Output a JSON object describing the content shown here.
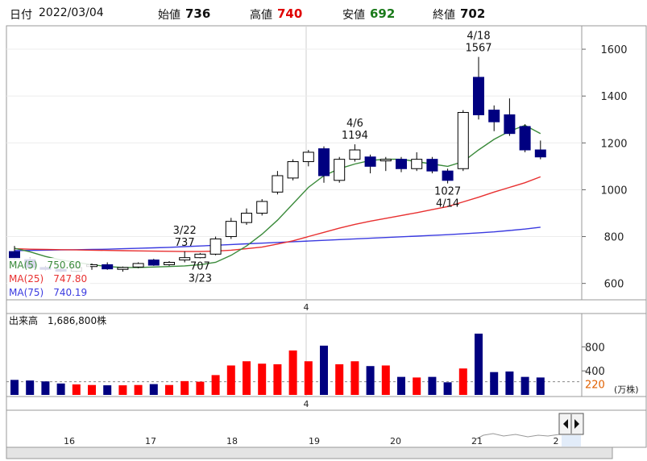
{
  "header": {
    "date_label": "日付",
    "date": "2022/03/04",
    "open_label": "始値",
    "open": "736",
    "high_label": "高値",
    "high": "740",
    "low_label": "安値",
    "low": "692",
    "close_label": "終値",
    "close": "702"
  },
  "legend": {
    "ma5": "MA(5)　750.60",
    "ma25": "MA(25)　747.80",
    "ma75": "MA(75)　740.19",
    "volume": "出来高　1,686,800株"
  },
  "colors": {
    "up": "#ff0000",
    "down": "#000080",
    "ma5": "#3a8a3a",
    "ma25": "#e83030",
    "ma75": "#3a3ae0"
  },
  "chart_data": {
    "type": "candlestick",
    "price_axis": {
      "ticks": [
        600,
        800,
        1000,
        1200,
        1400,
        1600
      ],
      "ylim": [
        530,
        1700
      ]
    },
    "volume_axis": {
      "ticks": [
        400,
        800
      ],
      "ylim": [
        0,
        1100
      ],
      "unit": "(万株)",
      "ref_line": 220
    },
    "week_marker": "4",
    "candles": [
      {
        "o": 736,
        "h": 760,
        "l": 700,
        "c": 705
      },
      {
        "o": 702,
        "h": 710,
        "l": 660,
        "c": 668
      },
      {
        "o": 668,
        "h": 675,
        "l": 655,
        "c": 660
      },
      {
        "o": 660,
        "h": 670,
        "l": 648,
        "c": 652
      },
      {
        "o": 652,
        "h": 672,
        "l": 648,
        "c": 668
      },
      {
        "o": 672,
        "h": 685,
        "l": 658,
        "c": 680
      },
      {
        "o": 680,
        "h": 690,
        "l": 658,
        "c": 662
      },
      {
        "o": 660,
        "h": 672,
        "l": 650,
        "c": 668
      },
      {
        "o": 670,
        "h": 690,
        "l": 665,
        "c": 685
      },
      {
        "o": 700,
        "h": 705,
        "l": 675,
        "c": 678
      },
      {
        "o": 680,
        "h": 695,
        "l": 675,
        "c": 690
      },
      {
        "o": 700,
        "h": 737,
        "l": 690,
        "c": 710
      },
      {
        "o": 710,
        "h": 730,
        "l": 707,
        "c": 725
      },
      {
        "o": 725,
        "h": 800,
        "l": 720,
        "c": 790
      },
      {
        "o": 800,
        "h": 880,
        "l": 790,
        "c": 865
      },
      {
        "o": 860,
        "h": 920,
        "l": 850,
        "c": 900
      },
      {
        "o": 900,
        "h": 960,
        "l": 890,
        "c": 950
      },
      {
        "o": 990,
        "h": 1080,
        "l": 980,
        "c": 1060
      },
      {
        "o": 1050,
        "h": 1130,
        "l": 1040,
        "c": 1120
      },
      {
        "o": 1120,
        "h": 1170,
        "l": 1100,
        "c": 1160
      },
      {
        "o": 1175,
        "h": 1185,
        "l": 1030,
        "c": 1060
      },
      {
        "o": 1040,
        "h": 1140,
        "l": 1030,
        "c": 1130
      },
      {
        "o": 1130,
        "h": 1194,
        "l": 1120,
        "c": 1170
      },
      {
        "o": 1140,
        "h": 1150,
        "l": 1070,
        "c": 1100
      },
      {
        "o": 1130,
        "h": 1140,
        "l": 1080,
        "c": 1130
      },
      {
        "o": 1130,
        "h": 1140,
        "l": 1075,
        "c": 1090
      },
      {
        "o": 1090,
        "h": 1160,
        "l": 1080,
        "c": 1130
      },
      {
        "o": 1130,
        "h": 1140,
        "l": 1070,
        "c": 1080
      },
      {
        "o": 1080,
        "h": 1090,
        "l": 1027,
        "c": 1040
      },
      {
        "o": 1090,
        "h": 1340,
        "l": 1080,
        "c": 1330
      },
      {
        "o": 1480,
        "h": 1567,
        "l": 1300,
        "c": 1320
      },
      {
        "o": 1340,
        "h": 1360,
        "l": 1250,
        "c": 1290
      },
      {
        "o": 1320,
        "h": 1390,
        "l": 1230,
        "c": 1240
      },
      {
        "o": 1270,
        "h": 1280,
        "l": 1160,
        "c": 1170
      },
      {
        "o": 1170,
        "h": 1210,
        "l": 1130,
        "c": 1140
      }
    ],
    "volume": [
      250,
      240,
      225,
      190,
      175,
      165,
      160,
      160,
      165,
      180,
      165,
      230,
      220,
      330,
      490,
      560,
      520,
      510,
      740,
      560,
      820,
      510,
      560,
      480,
      490,
      300,
      290,
      300,
      210,
      440,
      1020,
      380,
      390,
      300,
      290
    ],
    "ma5": [
      750,
      735,
      715,
      700,
      690,
      680,
      672,
      668,
      668,
      670,
      672,
      675,
      680,
      690,
      720,
      760,
      810,
      870,
      940,
      1010,
      1060,
      1090,
      1110,
      1125,
      1130,
      1130,
      1120,
      1110,
      1100,
      1120,
      1170,
      1215,
      1250,
      1275,
      1240
    ],
    "ma25": [
      748,
      746,
      745,
      744,
      743,
      742,
      741,
      740,
      739,
      738,
      737,
      736,
      736,
      738,
      742,
      748,
      755,
      768,
      782,
      800,
      818,
      836,
      852,
      866,
      878,
      890,
      902,
      915,
      928,
      948,
      968,
      990,
      1010,
      1030,
      1055
    ],
    "ma75": [
      740,
      741,
      742,
      743,
      744,
      745,
      746,
      748,
      750,
      752,
      754,
      757,
      760,
      763,
      766,
      769,
      772,
      775,
      778,
      781,
      784,
      787,
      790,
      793,
      796,
      799,
      802,
      805,
      808,
      812,
      816,
      820,
      826,
      832,
      840
    ],
    "annotations": [
      {
        "index": 11,
        "text": "3/22",
        "text2": "737",
        "where": "above"
      },
      {
        "index": 12,
        "text": "707",
        "text2": "3/23",
        "where": "below"
      },
      {
        "index": 22,
        "text": "4/6",
        "text2": "1194",
        "where": "above"
      },
      {
        "index": 28,
        "text": "1027",
        "text2": "4/14",
        "where": "below"
      },
      {
        "index": 30,
        "text": "4/18",
        "text2": "1567",
        "where": "above"
      }
    ],
    "day_ticks": [
      "16",
      "17",
      "18",
      "19",
      "20",
      "21",
      "2"
    ]
  }
}
